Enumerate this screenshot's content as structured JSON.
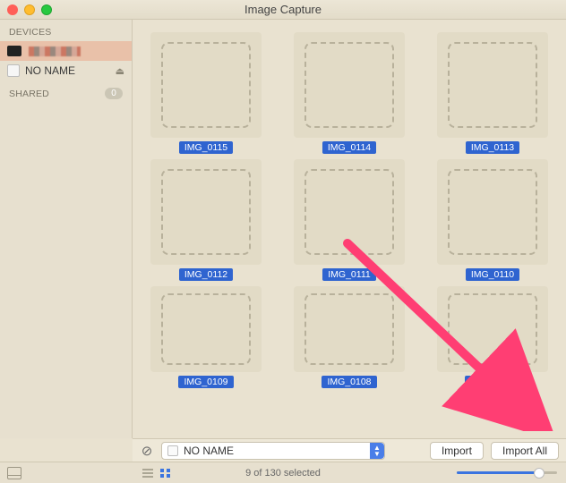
{
  "window": {
    "title": "Image Capture"
  },
  "sidebar": {
    "heading_devices": "DEVICES",
    "heading_shared": "SHARED",
    "shared_count": "0",
    "items": [
      {
        "label": "",
        "selected": true
      },
      {
        "label": "NO NAME",
        "selected": false,
        "ejectable": true
      }
    ]
  },
  "grid": {
    "items": [
      {
        "name": "IMG_0115"
      },
      {
        "name": "IMG_0114"
      },
      {
        "name": "IMG_0113"
      },
      {
        "name": "IMG_0112"
      },
      {
        "name": "IMG_0111"
      },
      {
        "name": "IMG_0110"
      },
      {
        "name": "IMG_0109"
      },
      {
        "name": "IMG_0108"
      },
      {
        "name": "IMG_0107"
      }
    ]
  },
  "importbar": {
    "destination": "NO NAME",
    "import_label": "Import",
    "import_all_label": "Import All"
  },
  "footer": {
    "status": "9 of 130 selected"
  }
}
